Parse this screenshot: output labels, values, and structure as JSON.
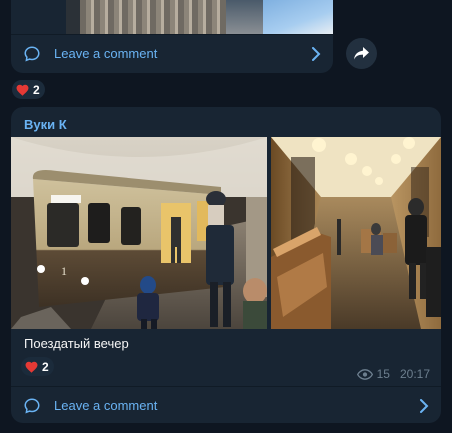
{
  "top_message": {
    "comment_label": "Leave a comment",
    "reaction": {
      "emoji": "heart",
      "count": "2"
    }
  },
  "main_message": {
    "author": "Вуки К",
    "caption": "Поездатый вечер",
    "reaction": {
      "emoji": "heart",
      "count": "2"
    },
    "views": "15",
    "time": "20:17",
    "comment_label": "Leave a comment"
  },
  "colors": {
    "background": "#0e1621",
    "bubble": "#182533",
    "accent": "#6ab3f3",
    "heart": "#e53935",
    "meta": "#6d7f8f"
  }
}
